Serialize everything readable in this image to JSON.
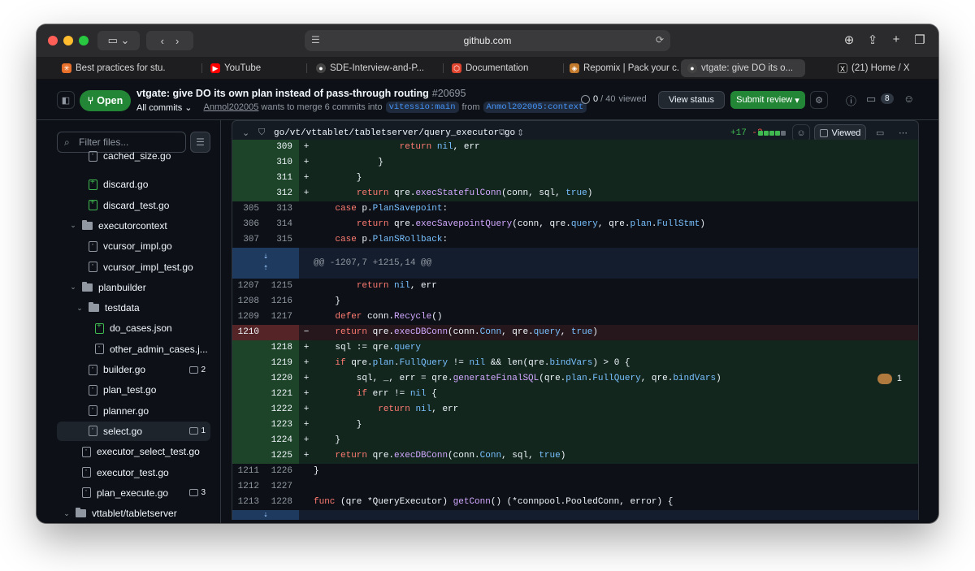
{
  "browser": {
    "url": "github.com",
    "tabs": [
      {
        "label": "Best practices for stu...",
        "icon_color": "#e8702a",
        "icon": "✳"
      },
      {
        "label": "YouTube",
        "icon_color": "#ff0000",
        "icon": "▶"
      },
      {
        "label": "SDE-Interview-and-P...",
        "icon_color": "#444444",
        "icon": "●"
      },
      {
        "label": "Documentation",
        "icon_color": "#e0452f",
        "icon": "⬡"
      },
      {
        "label": "Repomix | Pack your c...",
        "icon_color": "#c47a2c",
        "icon": "◈"
      },
      {
        "label": "vtgate: give DO its o...",
        "icon_color": "#444444",
        "icon": "●"
      },
      {
        "label": "(21) Home / X",
        "icon_color": "#111111",
        "icon": "X"
      }
    ]
  },
  "pr": {
    "state": "Open",
    "title": "vtgate: give DO its own plan instead of pass-through routing",
    "number": "#20695",
    "all_commits": "All commits",
    "author": "Anmol202005",
    "merge_text": "wants to merge 6 commits into",
    "base_branch": "vitessio:main",
    "from_text": "from",
    "head_branch": "Anmol202005:context",
    "viewed_num": "0",
    "viewed_total": "/ 40",
    "viewed_label": "viewed",
    "view_status": "View status",
    "submit_review": "Submit review",
    "comment_count": "8"
  },
  "sidebar": {
    "filter_placeholder": "Filter files...",
    "items": [
      {
        "label": "cached_size.go",
        "type": "file-mod",
        "indent": 2,
        "comments": ""
      },
      {
        "label": "discard.go",
        "type": "file-add",
        "indent": 2,
        "comments": ""
      },
      {
        "label": "discard_test.go",
        "type": "file-add",
        "indent": 2,
        "comments": ""
      },
      {
        "label": "executorcontext",
        "type": "folder",
        "indent": 1,
        "comments": ""
      },
      {
        "label": "vcursor_impl.go",
        "type": "file-mod",
        "indent": 2,
        "comments": ""
      },
      {
        "label": "vcursor_impl_test.go",
        "type": "file-mod",
        "indent": 2,
        "comments": ""
      },
      {
        "label": "planbuilder",
        "type": "folder",
        "indent": 1,
        "comments": ""
      },
      {
        "label": "testdata",
        "type": "folder",
        "indent": 2,
        "comments": ""
      },
      {
        "label": "do_cases.json",
        "type": "file-add",
        "indent": 3,
        "comments": ""
      },
      {
        "label": "other_admin_cases.j...",
        "type": "file-mod",
        "indent": 3,
        "comments": ""
      },
      {
        "label": "builder.go",
        "type": "file-mod",
        "indent": 2,
        "comments": "2"
      },
      {
        "label": "plan_test.go",
        "type": "file-mod",
        "indent": 2,
        "comments": ""
      },
      {
        "label": "planner.go",
        "type": "file-mod",
        "indent": 2,
        "comments": ""
      },
      {
        "label": "select.go",
        "type": "file-mod",
        "indent": 2,
        "comments": "1"
      },
      {
        "label": "executor_select_test.go",
        "type": "file-mod",
        "indent": 1,
        "comments": ""
      },
      {
        "label": "executor_test.go",
        "type": "file-mod",
        "indent": 1,
        "comments": ""
      },
      {
        "label": "plan_execute.go",
        "type": "file-mod",
        "indent": 1,
        "comments": "3"
      },
      {
        "label": "vttablet/tabletserver",
        "type": "folder",
        "indent": 0,
        "comments": ""
      }
    ]
  },
  "diff": {
    "path": "go/vt/vttablet/tabletserver/query_executor.go",
    "additions": "+17",
    "deletions": "-2",
    "viewed_label": "Viewed",
    "hunk_header": "@@ -1207,7 +1215,14 @@",
    "reaction_count": "1",
    "lines": [
      {
        "kind": "add",
        "old": "",
        "new": "309",
        "code": "                return nil, err"
      },
      {
        "kind": "add",
        "old": "",
        "new": "310",
        "code": "            }"
      },
      {
        "kind": "add",
        "old": "",
        "new": "311",
        "code": "        }"
      },
      {
        "kind": "add",
        "old": "",
        "new": "312",
        "code": "        return qre.execStatefulConn(conn, sql, true)"
      },
      {
        "kind": "ctx",
        "old": "305",
        "new": "313",
        "code": "    case p.PlanSavepoint:"
      },
      {
        "kind": "ctx",
        "old": "306",
        "new": "314",
        "code": "        return qre.execSavepointQuery(conn, qre.query, qre.plan.FullStmt)"
      },
      {
        "kind": "ctx",
        "old": "307",
        "new": "315",
        "code": "    case p.PlanSRollback:"
      },
      {
        "kind": "hunk",
        "old": "",
        "new": "",
        "code": ""
      },
      {
        "kind": "ctx",
        "old": "1207",
        "new": "1215",
        "code": "        return nil, err"
      },
      {
        "kind": "ctx",
        "old": "1208",
        "new": "1216",
        "code": "    }"
      },
      {
        "kind": "ctx",
        "old": "1209",
        "new": "1217",
        "code": "    defer conn.Recycle()"
      },
      {
        "kind": "del",
        "old": "1210",
        "new": "",
        "code": "    return qre.execDBConn(conn.Conn, qre.query, true)"
      },
      {
        "kind": "add",
        "old": "",
        "new": "1218",
        "code": "    sql := qre.query"
      },
      {
        "kind": "add",
        "old": "",
        "new": "1219",
        "code": "    if qre.plan.FullQuery != nil && len(qre.bindVars) > 0 {"
      },
      {
        "kind": "add",
        "old": "",
        "new": "1220",
        "code": "        sql, _, err = qre.generateFinalSQL(qre.plan.FullQuery, qre.bindVars)"
      },
      {
        "kind": "add",
        "old": "",
        "new": "1221",
        "code": "        if err != nil {"
      },
      {
        "kind": "add",
        "old": "",
        "new": "1222",
        "code": "            return nil, err"
      },
      {
        "kind": "add",
        "old": "",
        "new": "1223",
        "code": "        }"
      },
      {
        "kind": "add",
        "old": "",
        "new": "1224",
        "code": "    }"
      },
      {
        "kind": "add",
        "old": "",
        "new": "1225",
        "code": "    return qre.execDBConn(conn.Conn, sql, true)"
      },
      {
        "kind": "ctx",
        "old": "1211",
        "new": "1226",
        "code": "}"
      },
      {
        "kind": "ctx",
        "old": "1212",
        "new": "1227",
        "code": ""
      },
      {
        "kind": "ctx",
        "old": "1213",
        "new": "1228",
        "code": "func (qre *QueryExecutor) getConn() (*connpool.PooledConn, error) {"
      }
    ]
  },
  "colors": {
    "accent_green": "#238636",
    "add_text": "#3fb950",
    "del_text": "#f85149"
  }
}
